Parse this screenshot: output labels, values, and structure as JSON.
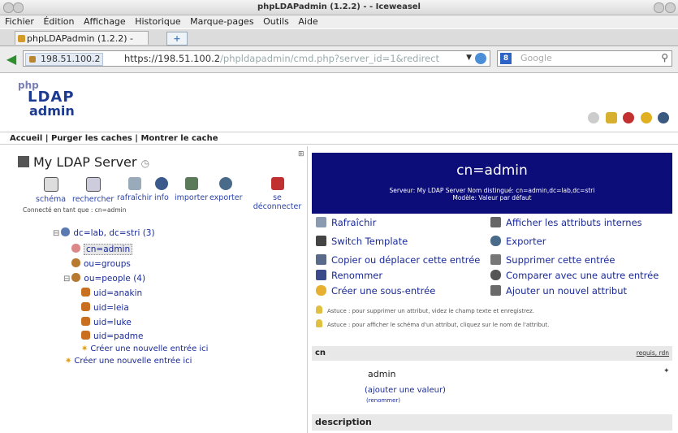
{
  "window": {
    "title": "phpLDAPadmin (1.2.2) - - Iceweasel"
  },
  "menu": [
    "Fichier",
    "Édition",
    "Affichage",
    "Historique",
    "Marque-pages",
    "Outils",
    "Aide"
  ],
  "tab": {
    "label": "phpLDAPadmin (1.2.2) -"
  },
  "address": {
    "site": "198.51.100.2",
    "prefix": "https://198.51.100.2",
    "path": "/phpldapadmin/cmd.php?server_id=1&redirect"
  },
  "search": {
    "engine": "8",
    "placeholder": "Google"
  },
  "logo": {
    "line1": "php",
    "line2": "LDAP",
    "line3": "admin"
  },
  "links": {
    "home": "Accueil",
    "purge": "Purger les caches",
    "show": "Montrer le cache",
    "sep": " | "
  },
  "server": {
    "name": "My LDAP Server",
    "connected": "Connecté en tant que : cn=admin"
  },
  "toolbar": [
    "schéma",
    "rechercher",
    "rafraîchir",
    "info",
    "importer",
    "exporter",
    "se déconnecter"
  ],
  "tree": {
    "root": "dc=lab, dc=stri (3)",
    "admin": "cn=admin",
    "groups": "ou=groups",
    "people": "ou=people (4)",
    "users": [
      "uid=anakin",
      "uid=leia",
      "uid=luke",
      "uid=padme"
    ],
    "create_here": "Créer une nouvelle entrée ici",
    "create_root": "Créer une nouvelle entrée ici"
  },
  "entry": {
    "dn": "cn=admin",
    "server_line": "Serveur: My LDAP Server   Nom distingué: cn=admin,dc=lab,dc=stri",
    "model_line": "Modèle: Valeur par défaut"
  },
  "actions_left": [
    "Rafraîchir",
    "Switch Template",
    "Copier ou déplacer cette entrée",
    "Renommer",
    "Créer une sous-entrée"
  ],
  "actions_right": [
    "Afficher les attributs internes",
    "Exporter",
    "Supprimer cette entrée",
    "Comparer avec une autre entrée",
    "Ajouter un nouvel attribut"
  ],
  "hints": [
    "Astuce : pour supprimer un attribut, videz le champ texte et enregistrez.",
    "Astuce : pour afficher le schéma d'un attribut, cliquez sur le nom de l'attribut."
  ],
  "attributes": {
    "cn_label": "cn",
    "required": "requis, rdn",
    "cn_value": "admin",
    "add_value": "(ajouter une valeur)",
    "rename": "(renommer)",
    "desc_label": "description"
  },
  "colors": {
    "banner": "#0d0d7a",
    "link": "#1a2a99"
  }
}
